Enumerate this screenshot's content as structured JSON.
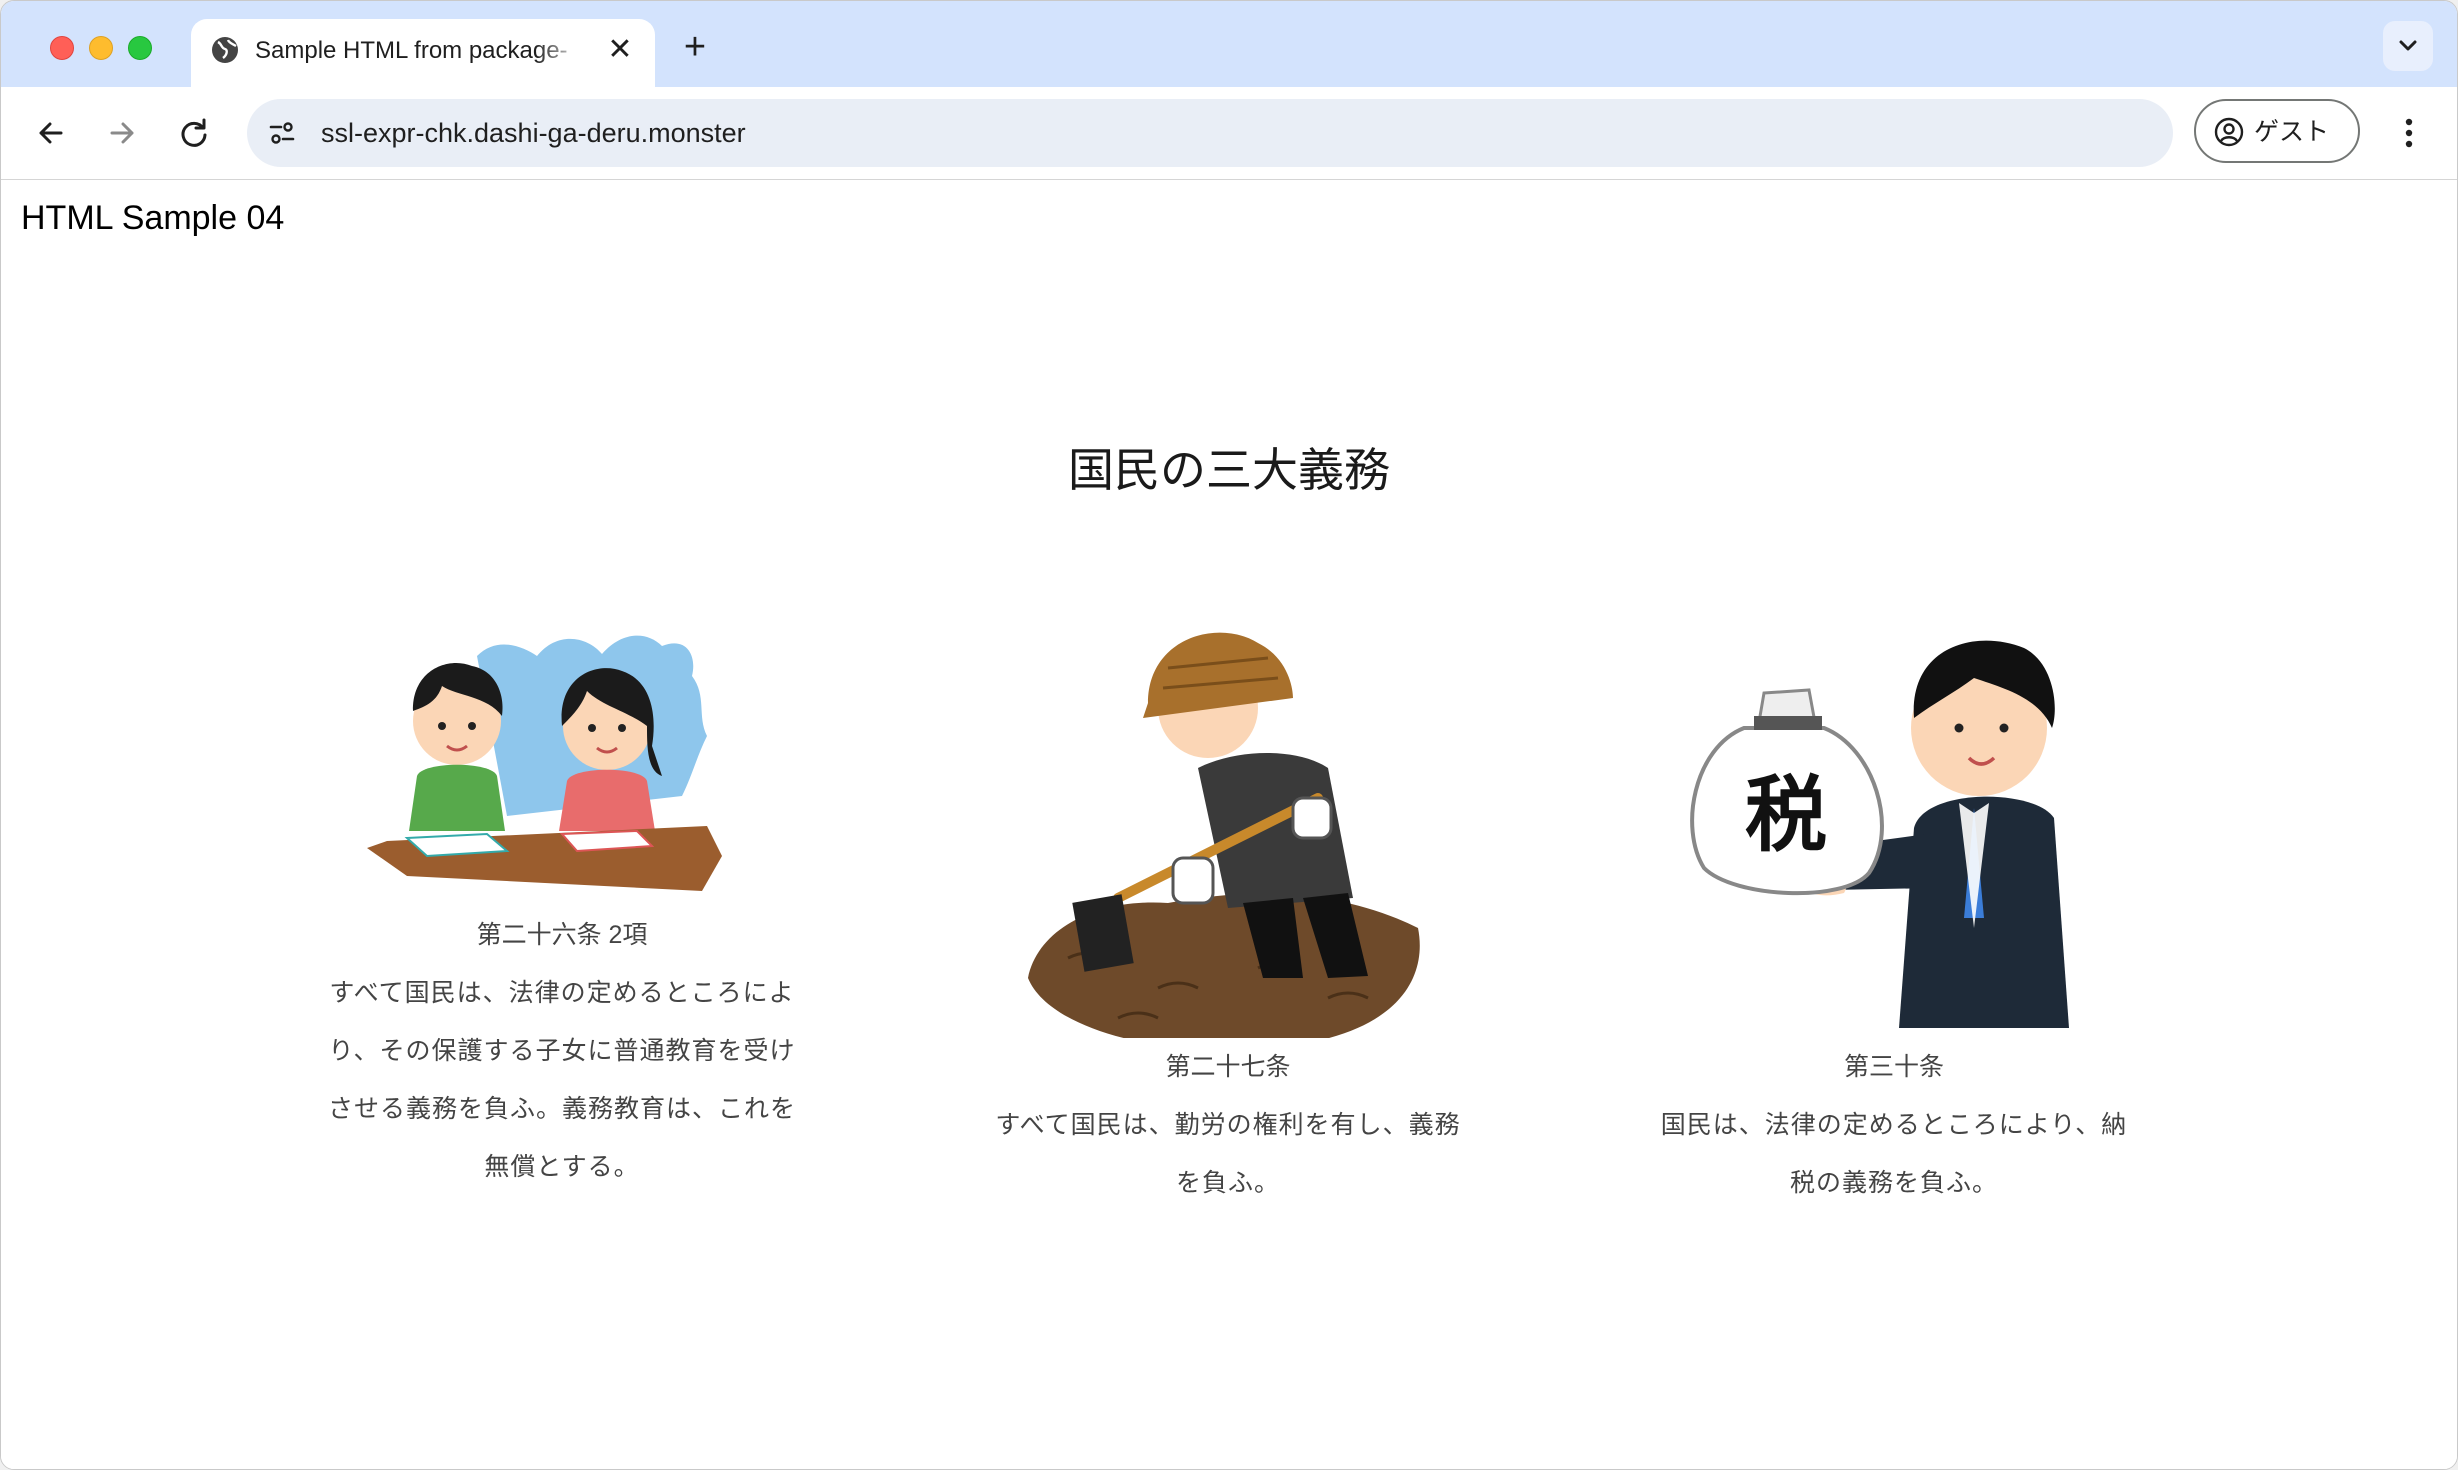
{
  "browser": {
    "tab_title": "Sample HTML from package-",
    "new_tab_symbol": "+",
    "tab_close_symbol": "✕",
    "url": "ssl-expr-chk.dashi-ga-deru.monster",
    "profile_label": "ゲスト",
    "icons": {
      "back": "arrow-left-icon",
      "forward": "arrow-right-icon",
      "reload": "reload-icon",
      "site_info": "tune-icon",
      "profile": "account-circle-icon",
      "menu": "more-vertical-icon",
      "tab_list": "chevron-down-icon",
      "tab_favicon": "globe-icon"
    }
  },
  "page": {
    "heading": "HTML Sample 04",
    "title": "国民の三大義務",
    "articles": [
      {
        "article": "第二十六条 2項",
        "text": "すべて国民は、法律の定めるところにより、その保護する子女に普通教育を受けさせる義務を負ふ。義務教育は、これを無償とする。",
        "illustration": "children-studying-illustration"
      },
      {
        "article": "第二十七条",
        "text": "すべて国民は、勤労の権利を有し、義務を負ふ。",
        "illustration": "worker-digging-illustration"
      },
      {
        "article": "第三十条",
        "text": "国民は、法律の定めるところにより、納税の義務を負ふ。",
        "illustration": "businessman-tax-bag-illustration",
        "bag_text": "税"
      }
    ]
  },
  "colors": {
    "tabbar_bg": "#d3e3fd",
    "omnibox_bg": "#e9eef6",
    "text_gray": "#444444"
  }
}
